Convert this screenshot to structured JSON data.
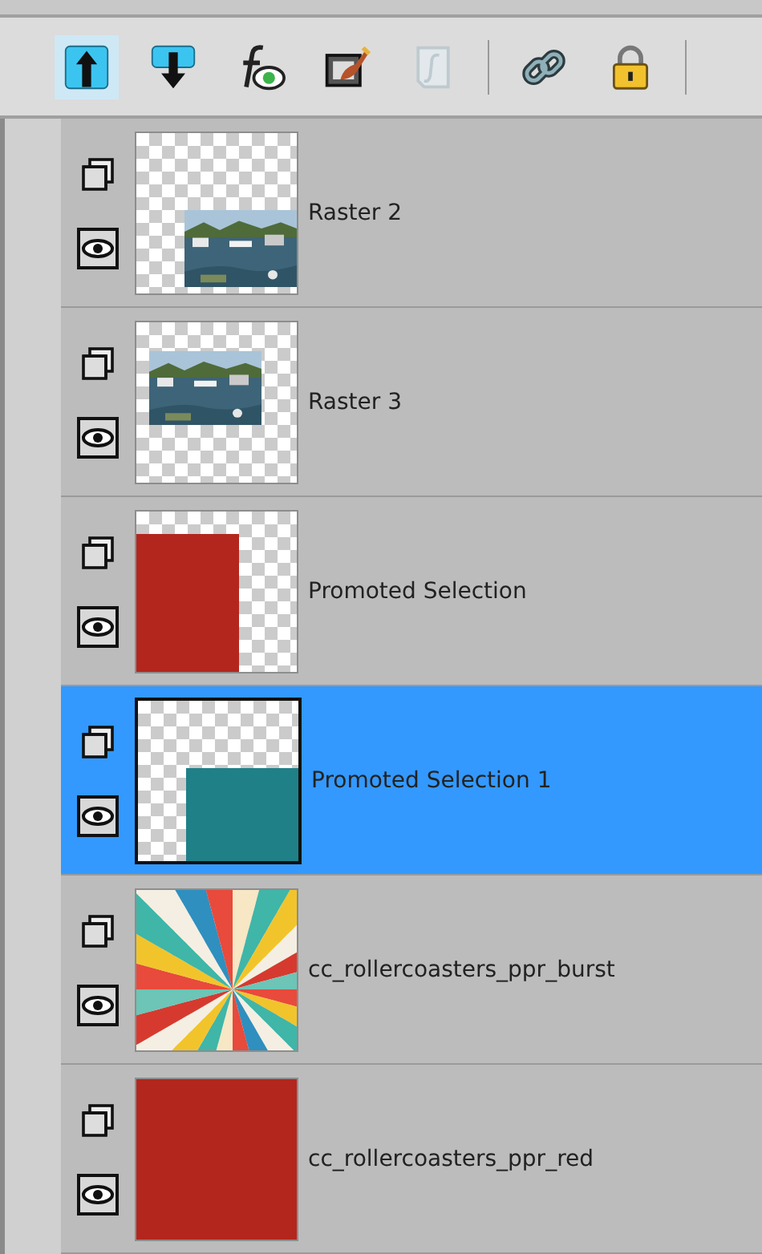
{
  "toolbar": [
    {
      "kind": "move-up",
      "selected": true,
      "disabled": false
    },
    {
      "kind": "move-down",
      "selected": false,
      "disabled": false
    },
    {
      "kind": "fx-eye",
      "selected": false,
      "disabled": false
    },
    {
      "kind": "brush-frame",
      "selected": false,
      "disabled": false
    },
    {
      "kind": "script",
      "selected": false,
      "disabled": true,
      "separator_after": true
    },
    {
      "kind": "link",
      "selected": false,
      "disabled": false
    },
    {
      "kind": "lock",
      "selected": false,
      "disabled": false,
      "separator_after": true
    }
  ],
  "layers": [
    {
      "name": "Raster 2",
      "selected": false,
      "thumbnail": {
        "kind": "photo-corner"
      }
    },
    {
      "name": "Raster 3",
      "selected": false,
      "thumbnail": {
        "kind": "photo-center"
      }
    },
    {
      "name": "Promoted Selection",
      "selected": false,
      "thumbnail": {
        "kind": "fill-left",
        "color": "#b3261e"
      }
    },
    {
      "name": "Promoted Selection 1",
      "selected": true,
      "thumbnail": {
        "kind": "fill-corner",
        "color": "#1f8087"
      }
    },
    {
      "name": "cc_rollercoasters_ppr_burst",
      "selected": false,
      "thumbnail": {
        "kind": "burst"
      }
    },
    {
      "name": "cc_rollercoasters_ppr_red",
      "selected": false,
      "thumbnail": {
        "kind": "fill-full",
        "color": "#b3261e"
      }
    }
  ]
}
